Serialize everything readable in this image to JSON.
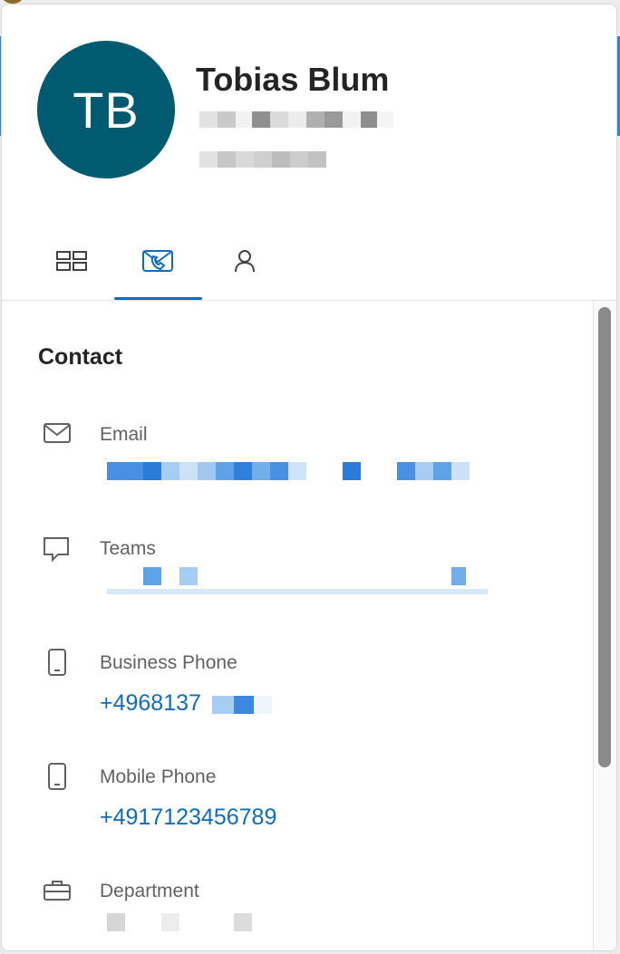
{
  "profile": {
    "initials": "TB",
    "name": "Tobias Blum",
    "avatar_color": "#005b70"
  },
  "tabs": [
    {
      "id": "overview",
      "icon": "overview-grid-icon"
    },
    {
      "id": "contact",
      "icon": "contact-card-icon",
      "selected": true
    },
    {
      "id": "organization",
      "icon": "person-icon"
    }
  ],
  "contact": {
    "section_title": "Contact",
    "email": {
      "label": "Email",
      "icon": "mail-icon"
    },
    "teams": {
      "label": "Teams",
      "icon": "chat-icon"
    },
    "business_phone": {
      "label": "Business Phone",
      "value": "+4968137",
      "icon": "phone-icon"
    },
    "mobile_phone": {
      "label": "Mobile Phone",
      "value": "+4917123456789",
      "icon": "phone-icon"
    },
    "department": {
      "label": "Department",
      "icon": "briefcase-icon"
    }
  },
  "colors": {
    "accent": "#0f6cbd",
    "label": "#616161",
    "text": "#242424"
  }
}
